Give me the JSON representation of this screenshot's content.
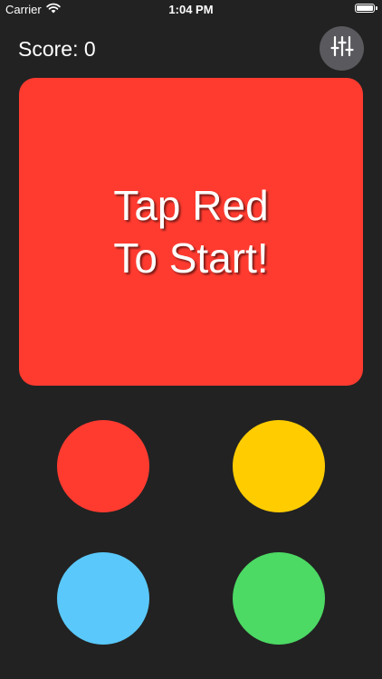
{
  "status_bar": {
    "carrier": "Carrier",
    "time": "1:04 PM",
    "wifi_icon": "wifi-icon",
    "battery_icon": "battery-icon",
    "battery_level": 1.0
  },
  "header": {
    "score_label": "Score: 0",
    "settings_icon": "sliders-icon"
  },
  "tap_panel": {
    "line1": "Tap Red",
    "line2": "To Start!",
    "color": "#ff3b30"
  },
  "color_buttons": [
    {
      "name": "red",
      "color": "#ff3b30"
    },
    {
      "name": "yellow",
      "color": "#ffcc00"
    },
    {
      "name": "blue",
      "color": "#5ac8fa"
    },
    {
      "name": "green",
      "color": "#4cd964"
    }
  ],
  "colors": {
    "background": "#222222",
    "settings_button": "#5a5a5e",
    "text": "#ffffff"
  }
}
